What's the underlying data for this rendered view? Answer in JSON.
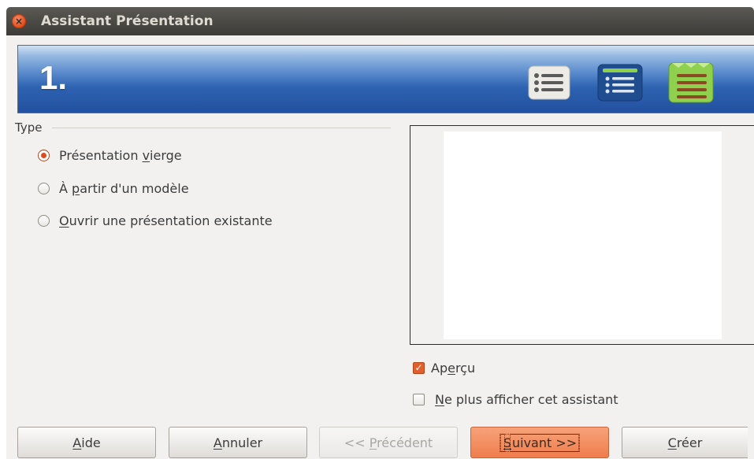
{
  "window": {
    "title": "Assistant Présentation"
  },
  "banner": {
    "step": "1.",
    "icons": [
      "bulleted-list-icon-gray",
      "bulleted-list-icon-blue",
      "bulleted-list-icon-green"
    ]
  },
  "type_group": {
    "label": "Type",
    "options": [
      {
        "pre": "Présentation ",
        "mnemonic": "v",
        "post": "ierge",
        "checked": true
      },
      {
        "pre": "À ",
        "mnemonic": "p",
        "post": "artir d'un modèle",
        "checked": false
      },
      {
        "pre": "",
        "mnemonic": "O",
        "post": "uvrir une présentation existante",
        "checked": false
      }
    ]
  },
  "options": {
    "preview": {
      "pre": "Ap",
      "mnemonic": "e",
      "post": "rçu",
      "checked": true
    },
    "no_show": {
      "pre": "",
      "mnemonic": "N",
      "post": "e plus afficher cet assistant",
      "checked": false
    }
  },
  "buttons": {
    "help": {
      "pre": "",
      "mnemonic": "A",
      "post": "ide"
    },
    "cancel": {
      "pre": "",
      "mnemonic": "A",
      "post": "nnuler"
    },
    "previous": {
      "pre": "<< ",
      "mnemonic": "P",
      "post": "récédent",
      "enabled": false
    },
    "next": {
      "pre": "",
      "mnemonic": "S",
      "post": "uivant >>"
    },
    "create": {
      "pre": "",
      "mnemonic": "C",
      "post": "réer"
    }
  },
  "colors": {
    "accent": "#e15f2e",
    "banner_blue": "#2d63b1",
    "titlebar": "#3c3b37"
  }
}
